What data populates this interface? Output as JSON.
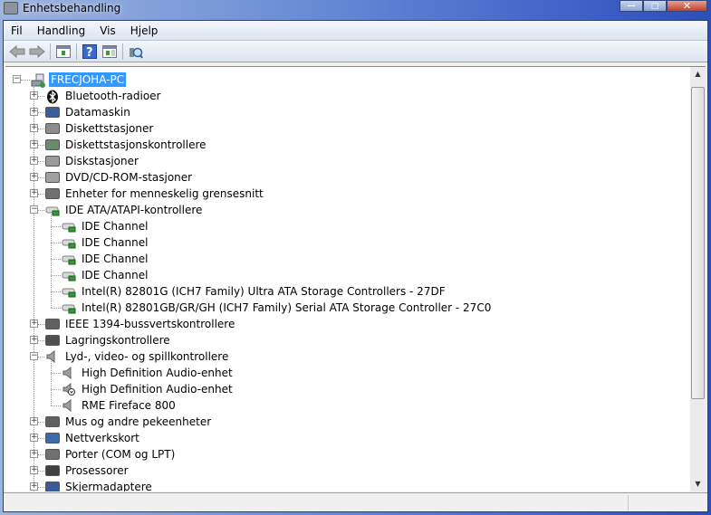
{
  "window": {
    "title": "Enhetsbehandling",
    "min": "—",
    "max": "□",
    "close": "✕"
  },
  "menu": [
    "Fil",
    "Handling",
    "Vis",
    "Hjelp"
  ],
  "toolbar": [
    "back-icon",
    "forward-icon",
    "show-hide-console-tree-icon",
    "help-icon",
    "show-action-pane-icon",
    "scan-hardware-icon"
  ],
  "tree": {
    "root": "FRECJOHA-PC",
    "items": [
      {
        "label": "Bluetooth-radioer",
        "icon": "bluetooth-icon",
        "color": "#1a1a1a",
        "expanded": false
      },
      {
        "label": "Datamaskin",
        "icon": "computer-icon",
        "color": "#3b5f9c",
        "expanded": false
      },
      {
        "label": "Diskettstasjoner",
        "icon": "floppy-drive-icon",
        "color": "#8c8c8c",
        "expanded": false
      },
      {
        "label": "Diskettstasjonskontrollere",
        "icon": "floppy-controller-icon",
        "color": "#6b8c6b",
        "expanded": false
      },
      {
        "label": "Diskstasjoner",
        "icon": "disk-drive-icon",
        "color": "#9a9a9a",
        "expanded": false
      },
      {
        "label": "DVD/CD-ROM-stasjoner",
        "icon": "dvd-drive-icon",
        "color": "#a0a0a0",
        "expanded": false
      },
      {
        "label": "Enheter for menneskelig grensesnitt",
        "icon": "hid-icon",
        "color": "#707070",
        "expanded": false
      },
      {
        "label": "IDE ATA/ATAPI-kontrollere",
        "icon": "ide-controller-icon",
        "color": "#7ca07c",
        "expanded": true,
        "children": [
          {
            "label": "IDE Channel",
            "icon": "ide-channel-icon"
          },
          {
            "label": "IDE Channel",
            "icon": "ide-channel-icon"
          },
          {
            "label": "IDE Channel",
            "icon": "ide-channel-icon"
          },
          {
            "label": "IDE Channel",
            "icon": "ide-channel-icon"
          },
          {
            "label": "Intel(R) 82801G (ICH7 Family) Ultra ATA Storage Controllers - 27DF",
            "icon": "ide-channel-icon"
          },
          {
            "label": "Intel(R) 82801GB/GR/GH (ICH7 Family) Serial ATA Storage Controller - 27C0",
            "icon": "ide-channel-icon"
          }
        ]
      },
      {
        "label": "IEEE 1394-bussvertskontrollere",
        "icon": "firewire-icon",
        "color": "#606060",
        "expanded": false
      },
      {
        "label": "Lagringskontrollere",
        "icon": "storage-controller-icon",
        "color": "#505050",
        "expanded": false
      },
      {
        "label": "Lyd-, video- og spillkontrollere",
        "icon": "speaker-icon",
        "color": "#8a8a8a",
        "expanded": true,
        "children": [
          {
            "label": "High Definition Audio-enhet",
            "icon": "speaker-icon"
          },
          {
            "label": "High Definition Audio-enhet",
            "icon": "speaker-disabled-icon"
          },
          {
            "label": "RME Fireface 800",
            "icon": "speaker-icon"
          }
        ]
      },
      {
        "label": "Mus og andre pekeenheter",
        "icon": "mouse-icon",
        "color": "#606060",
        "expanded": false
      },
      {
        "label": "Nettverkskort",
        "icon": "network-icon",
        "color": "#3a6ab0",
        "expanded": false
      },
      {
        "label": "Porter (COM og LPT)",
        "icon": "port-icon",
        "color": "#707070",
        "expanded": false
      },
      {
        "label": "Prosessorer",
        "icon": "processor-icon",
        "color": "#404040",
        "expanded": false
      },
      {
        "label": "Skjermadaptere",
        "icon": "display-adapter-icon",
        "color": "#3a5a9a",
        "expanded": false
      }
    ]
  }
}
